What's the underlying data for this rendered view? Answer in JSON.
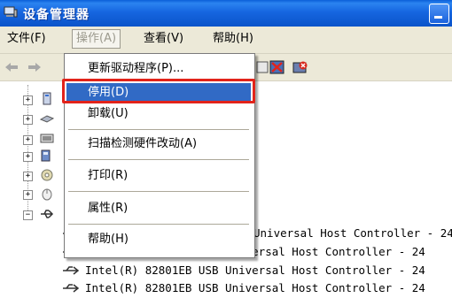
{
  "window": {
    "title": "设备管理器"
  },
  "menubar": {
    "file": "文件(F)",
    "action": "操作(A)",
    "view": "查看(V)",
    "help": "帮助(H)"
  },
  "dropdown": {
    "items": [
      "更新驱动程序(P)...",
      "停用(D)",
      "卸载(U)",
      "扫描检测硬件改动(A)",
      "打印(R)",
      "属性(R)",
      "帮助(H)"
    ]
  },
  "devices": [
    "Universal Host Controller - 24",
    "Intel(R) 82801EB USB Universal Host Controller - 24",
    "Intel(R) 82801EB USB Universal Host Controller - 24",
    "Intel(R) 82801EB USB Universal Host Controller - 24"
  ],
  "colors": {
    "titlebar": "#0a53c9",
    "selection": "#316ac5",
    "highlight": "#e2231a",
    "menubar": "#ece9d8"
  }
}
